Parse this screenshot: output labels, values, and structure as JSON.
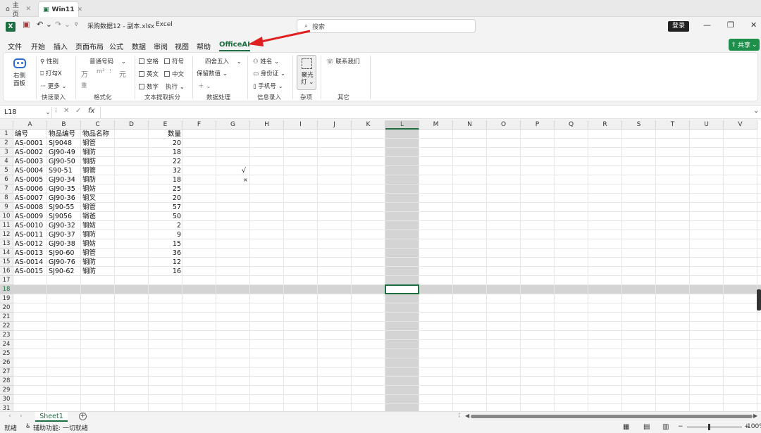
{
  "tabs": [
    {
      "label": "主页"
    },
    {
      "label": "Win11"
    }
  ],
  "title": {
    "filename": "采购数据12 - 副本.xlsx",
    "separator": "-",
    "app": "Excel",
    "search_placeholder": "搜索",
    "login": "登录"
  },
  "window_controls": {
    "minimize": "—",
    "restore": "❐",
    "close": "✕"
  },
  "menu": {
    "items": [
      "文件",
      "开始",
      "插入",
      "页面布局",
      "公式",
      "数据",
      "审阅",
      "视图",
      "帮助",
      "OfficeAI"
    ],
    "active": "OfficeAI",
    "share": "共享"
  },
  "ribbon": {
    "panel_label": "右侧\n面板",
    "quick_entry": {
      "gender": "性别",
      "check": "打勾X",
      "more": "··· 更多 ⌄",
      "label": "快速录入"
    },
    "format": {
      "number_format": "普通号码",
      "wan": "万",
      "m2": "m²",
      "yuan": "元",
      "chong": "重",
      "label": "格式化"
    },
    "text_extract": {
      "space": "空格",
      "symbol": "符号",
      "english": "英文",
      "chinese": "中文",
      "number": "数字",
      "execute": "执行 ⌄",
      "label": "文本提取拆分"
    },
    "data_process": {
      "round": "四舍五入",
      "keep_value": "保留数值",
      "plus": "＋ ⌄",
      "label": "数据处理"
    },
    "info_entry": {
      "name": "姓名 ⌄",
      "id_card": "身份证 ⌄",
      "phone": "手机号 ⌄",
      "label": "信息录入"
    },
    "misc": {
      "spotlight": "聚光\n灯 ⌄",
      "label": "杂项"
    },
    "other": {
      "contact": "联系我们",
      "label": "其它"
    }
  },
  "formula_bar": {
    "name_box": "L18",
    "fx": "fx",
    "cancel": "✕",
    "confirm": "✓",
    "value": ""
  },
  "grid": {
    "columns": [
      "A",
      "B",
      "C",
      "D",
      "E",
      "F",
      "G",
      "H",
      "I",
      "J",
      "K",
      "L",
      "M",
      "N",
      "O",
      "P",
      "Q",
      "R",
      "S",
      "T",
      "U",
      "V"
    ],
    "selected_column": "L",
    "selected_row": 18,
    "row_count": 31,
    "headers": {
      "A": "编号",
      "B": "物品编号",
      "C": "物品名称",
      "E": "数量"
    },
    "rows": [
      [
        "AS-0001",
        "SJ9048",
        "钢管",
        20
      ],
      [
        "AS-0002",
        "GJ90-49",
        "钢防",
        18
      ],
      [
        "AS-0003",
        "GJ90-50",
        "钢肪",
        22
      ],
      [
        "AS-0004",
        "S90-51",
        "钢管",
        32
      ],
      [
        "AS-0005",
        "GJ90-34",
        "钢肪",
        18
      ],
      [
        "AS-0006",
        "GJ90-35",
        "钢妨",
        25
      ],
      [
        "AS-0007",
        "GJ90-36",
        "钢叉",
        20
      ],
      [
        "AS-0008",
        "SJ90-55",
        "钢管",
        57
      ],
      [
        "AS-0009",
        "SJ9056",
        "锅爸",
        50
      ],
      [
        "AS-0010",
        "GJ90-32",
        "钢妨",
        2
      ],
      [
        "AS-0011",
        "GJ90-37",
        "钢防",
        9
      ],
      [
        "AS-0012",
        "GJ90-38",
        "钢妨",
        15
      ],
      [
        "AS-0013",
        "SJ90-60",
        "钢管",
        36
      ],
      [
        "AS-0014",
        "GJ90-76",
        "钢防",
        12
      ],
      [
        "AS-0015",
        "SJ90-62",
        "钢防",
        16
      ]
    ],
    "g5": "√",
    "g6": "×"
  },
  "sheets": {
    "names": [
      "Sheet1"
    ],
    "add": "+"
  },
  "status": {
    "ready": "就绪",
    "accessibility": "辅助功能: 一切就绪",
    "zoom": "100%"
  },
  "colors": {
    "accent": "#1d6f42",
    "share": "#1d8f4a",
    "annotation": "#e02020"
  }
}
